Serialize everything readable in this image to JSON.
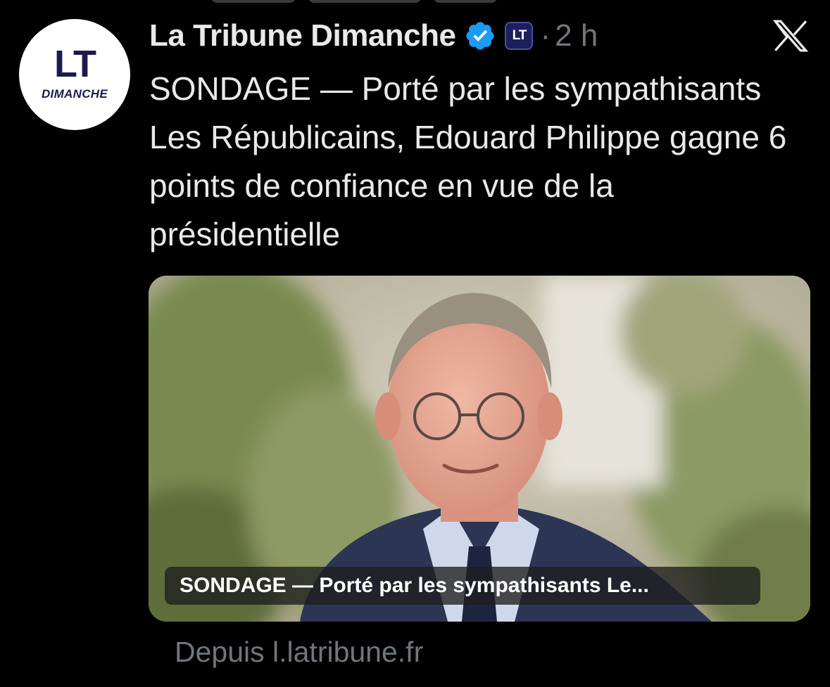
{
  "post": {
    "account_name": "La Tribune Dimanche",
    "time": "2 h",
    "separator": "·",
    "text": "SONDAGE — Porté par les sympathisants Les Républicains, Edouard Philippe gagne 6 points de confiance en vue de la présidentielle",
    "avatar_title": "LT",
    "avatar_subtitle": "DIMANCHE",
    "affiliate_badge": "LT",
    "verified": true,
    "icons": {
      "verified": "verified-badge-icon",
      "x": "x-logo-icon"
    }
  },
  "card": {
    "caption": "SONDAGE — Porté par les sympathisants Le...",
    "source": "Depuis l.latribune.fr"
  },
  "colors": {
    "background": "#000000",
    "text": "#e7e9ea",
    "secondary": "#71767b",
    "verified": "#1d9bf0",
    "badge": "#1d1f5c"
  }
}
